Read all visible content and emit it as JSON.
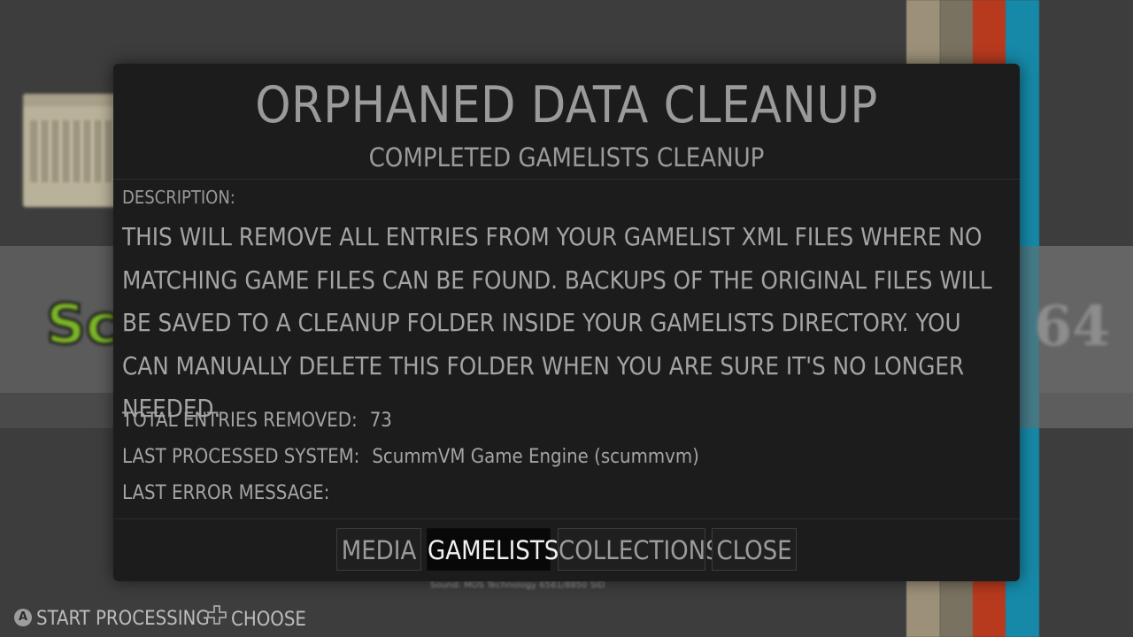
{
  "background": {
    "logo_left_text": "Sc",
    "logo_right_text": "64",
    "sound_text": "Sound: MOS Technology 6581/8850 SID"
  },
  "dialog": {
    "title": "ORPHANED DATA CLEANUP",
    "subtitle": "COMPLETED GAMELISTS CLEANUP",
    "description_label": "DESCRIPTION:",
    "description_text": "THIS WILL REMOVE ALL ENTRIES FROM YOUR GAMELIST XML FILES WHERE NO MATCHING GAME FILES CAN BE FOUND. BACKUPS OF THE ORIGINAL FILES WILL BE SAVED TO A CLEANUP FOLDER INSIDE YOUR GAMELISTS DIRECTORY. YOU CAN MANUALLY DELETE THIS FOLDER WHEN YOU ARE SURE IT'S NO LONGER NEEDED.",
    "info": {
      "total_label": "TOTAL ENTRIES REMOVED:",
      "total_value": "73",
      "last_system_label": "LAST PROCESSED SYSTEM:",
      "last_system_value": "ScummVM Game Engine (scummvm)",
      "last_error_label": "LAST ERROR MESSAGE:",
      "last_error_value": ""
    },
    "buttons": {
      "media": "MEDIA",
      "gamelists": "GAMELISTS",
      "collections": "COLLECTIONS",
      "close": "CLOSE"
    },
    "selected_button": "gamelists"
  },
  "help": {
    "a_button_glyph": "A",
    "a_action": "START PROCESSING",
    "dpad_action": "CHOOSE"
  },
  "colors": {
    "dialog_bg": "#1c1c1c",
    "text": "#9a9a9a",
    "selected_button_bg": "#080808",
    "selected_button_text": "#f2f2f2",
    "stripe_tan": "#9c9079",
    "stripe_olive": "#797260",
    "stripe_red": "#b73a1e",
    "stripe_blue": "#1689a8"
  }
}
